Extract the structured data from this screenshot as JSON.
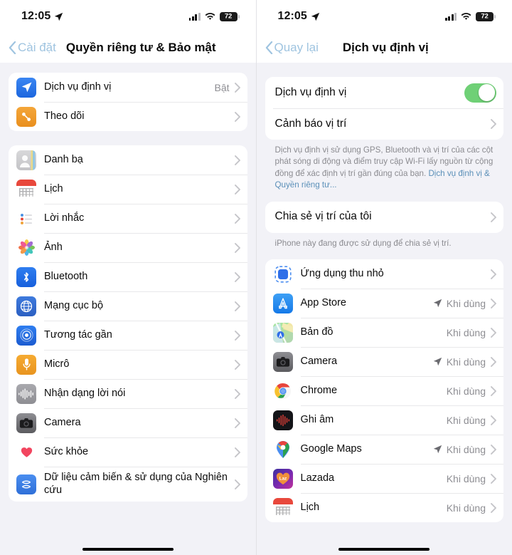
{
  "statusbar": {
    "time": "12:05",
    "location_arrow": "location-arrow-icon",
    "cellular": "cellular-bars-icon",
    "wifi": "wifi-icon",
    "battery_pct": "72"
  },
  "left_screen": {
    "nav": {
      "back_label": "Cài đặt",
      "title": "Quyền riêng tư & Bảo mật"
    },
    "group1": [
      {
        "label": "Dịch vụ định vị",
        "value": "Bật",
        "icon": "location-services-icon"
      },
      {
        "label": "Theo dõi",
        "value": "",
        "icon": "tracking-icon"
      }
    ],
    "group2": [
      {
        "label": "Danh bạ",
        "value": "",
        "icon": "contacts-icon"
      },
      {
        "label": "Lịch",
        "value": "",
        "icon": "calendar-icon"
      },
      {
        "label": "Lời nhắc",
        "value": "",
        "icon": "reminders-icon"
      },
      {
        "label": "Ảnh",
        "value": "",
        "icon": "photos-icon"
      },
      {
        "label": "Bluetooth",
        "value": "",
        "icon": "bluetooth-icon"
      },
      {
        "label": "Mạng cục bộ",
        "value": "",
        "icon": "local-network-icon"
      },
      {
        "label": "Tương tác gần",
        "value": "",
        "icon": "nearby-interactions-icon"
      },
      {
        "label": "Micrô",
        "value": "",
        "icon": "microphone-icon"
      },
      {
        "label": "Nhận dạng lời nói",
        "value": "",
        "icon": "speech-recognition-icon"
      },
      {
        "label": "Camera",
        "value": "",
        "icon": "camera-icon"
      },
      {
        "label": "Sức khỏe",
        "value": "",
        "icon": "health-icon"
      },
      {
        "label": "Dữ liệu cảm biến & sử dụng của Nghiên cứu",
        "value": "",
        "icon": "research-sensor-icon"
      }
    ]
  },
  "right_screen": {
    "nav": {
      "back_label": "Quay lại",
      "title": "Dịch vụ định vị"
    },
    "toggle_row": {
      "label": "Dịch vụ định vị",
      "state": "on"
    },
    "alerts_row": {
      "label": "Cảnh báo vị trí"
    },
    "description": "Dịch vụ định vị sử dụng GPS, Bluetooth và vị trí của các cột phát sóng di động và điểm truy cập Wi-Fi lấy nguồn từ cộng đồng để xác định vị trí gần đúng của bạn. ",
    "description_link": "Dịch vụ định vị & Quyền riêng tư...",
    "share_row": {
      "label": "Chia sẻ vị trí của tôi"
    },
    "share_footnote": "iPhone này đang được sử dụng để chia sẻ vị trí.",
    "apps": [
      {
        "label": "Ứng dụng thu nhỏ",
        "value": "",
        "arrow": false,
        "icon": "app-clips-icon"
      },
      {
        "label": "App Store",
        "value": "Khi dùng",
        "arrow": true,
        "icon": "app-store-icon"
      },
      {
        "label": "Bản đồ",
        "value": "Khi dùng",
        "arrow": false,
        "icon": "apple-maps-icon"
      },
      {
        "label": "Camera",
        "value": "Khi dùng",
        "arrow": true,
        "icon": "camera-icon"
      },
      {
        "label": "Chrome",
        "value": "Khi dùng",
        "arrow": false,
        "icon": "chrome-icon"
      },
      {
        "label": "Ghi âm",
        "value": "Khi dùng",
        "arrow": false,
        "icon": "voice-memos-icon"
      },
      {
        "label": "Google Maps",
        "value": "Khi dùng",
        "arrow": true,
        "icon": "google-maps-icon"
      },
      {
        "label": "Lazada",
        "value": "Khi dùng",
        "arrow": false,
        "icon": "lazada-icon"
      },
      {
        "label": "Lịch",
        "value": "Khi dùng",
        "arrow": false,
        "icon": "calendar-icon"
      }
    ]
  },
  "colors": {
    "accent_blue": "#3b86f2",
    "toggle_green": "#6fd076",
    "background": "#f2f2f7",
    "card": "#ffffff",
    "secondary_text": "#8e8e93"
  }
}
